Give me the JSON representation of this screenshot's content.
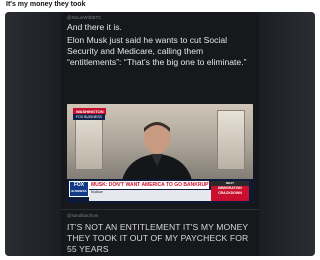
{
  "post": {
    "title": "It's my money they took"
  },
  "tweet": {
    "handle_top": "@NoLieWithBTC",
    "line1": "And there it is.",
    "line2": "Elon Musk just said he wants to cut Social Security and Medicare, calling them “entitlements”: “That’s the big one to eliminate.”"
  },
  "video": {
    "location": "WASHINGTON",
    "location_sub": "FOX BUSINESS",
    "network": "FOX",
    "network_sub": "BUSINESS",
    "headline": "MUSK: DON'T WANT AMERICA TO GO BANKRUPT",
    "show": "Kudlow",
    "watch_top": "NEXT",
    "watch_label": "IMMIGRATION CRACKDOWN"
  },
  "reply": {
    "handle": "@sandibachom",
    "caption": "IT'S NOT AN ENTITLEMENT IT'S MY MONEY THEY TOOK IT OUT OF MY PAYCHECK FOR 55 YEARS"
  }
}
